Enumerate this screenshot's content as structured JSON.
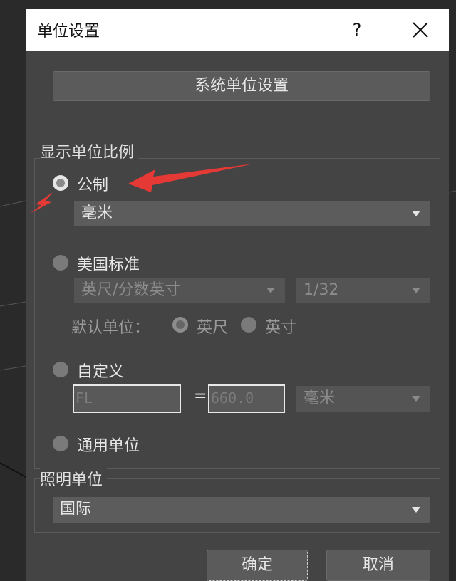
{
  "dialog": {
    "title": "单位设置",
    "help_label": "?",
    "close_icon": "close-icon"
  },
  "system_units_button": "系统单位设置",
  "display_unit_scale": {
    "label": "显示单位比例",
    "metric": {
      "label": "公制",
      "selected": true,
      "dropdown_value": "毫米"
    },
    "us_standard": {
      "label": "美国标准",
      "selected": false,
      "dropdown_value": "英尺/分数英寸",
      "fraction_value": "1/32",
      "default_unit_label": "默认单位：",
      "default_unit_options": [
        {
          "label": "英尺",
          "selected": true
        },
        {
          "label": "英寸",
          "selected": false
        }
      ]
    },
    "custom": {
      "label": "自定义",
      "selected": false,
      "name_value": "FL",
      "equals": "=",
      "number_value": "660.0",
      "unit_value": "毫米"
    },
    "generic": {
      "label": "通用单位",
      "selected": false
    }
  },
  "lighting_units": {
    "label": "照明单位",
    "dropdown_value": "国际"
  },
  "footer": {
    "ok_label": "确定",
    "cancel_label": "取消"
  },
  "colors": {
    "dialog_bg": "#444444",
    "annotation_arrow": "#e53935"
  }
}
